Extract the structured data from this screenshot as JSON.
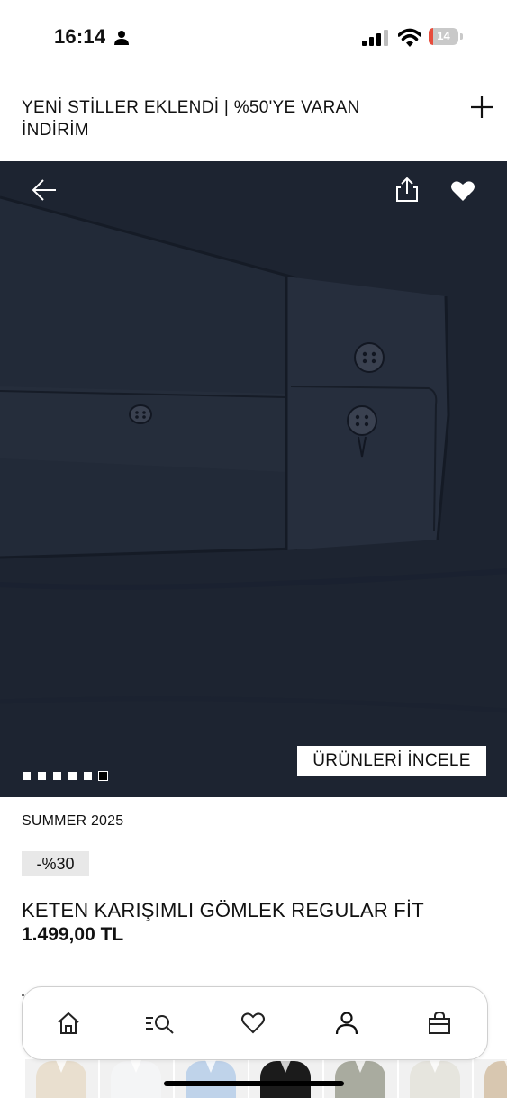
{
  "status_bar": {
    "time": "16:14",
    "battery_level": "14",
    "icons": [
      "person-icon",
      "signal-icon",
      "wifi-icon",
      "battery-icon"
    ]
  },
  "promo": {
    "text": "YENİ STİLLER EKLENDİ | %50'YE VARAN İNDİRİM",
    "expand_icon": "plus-icon"
  },
  "hero": {
    "toolbar_icons": [
      "back-arrow-icon",
      "share-icon",
      "heart-icon"
    ],
    "inspect_label": "ÜRÜNLERİ İNCELE",
    "image_count": 6,
    "active_image_index": 5
  },
  "product": {
    "collection": "SUMMER 2025",
    "discount": "-%30",
    "name": "KETEN KARIŞIMLI GÖMLEK REGULAR FİT",
    "price": "1.499,00 TL"
  },
  "bottom_nav": {
    "items": [
      "home-icon",
      "search-icon",
      "heart-icon",
      "account-icon",
      "bag-icon"
    ],
    "active": "account-icon"
  },
  "thumbnails": {
    "colors": [
      "#e9dfcf",
      "#f4f5f6",
      "#bfd3ea",
      "#1b1b1b",
      "#a9ab9f",
      "#e6e5de",
      "#d8c7b0"
    ]
  },
  "colors": {
    "hero_bg": "#1d2431",
    "discount_bg": "#e8e8e8",
    "battery_low": "#e74c3c"
  }
}
